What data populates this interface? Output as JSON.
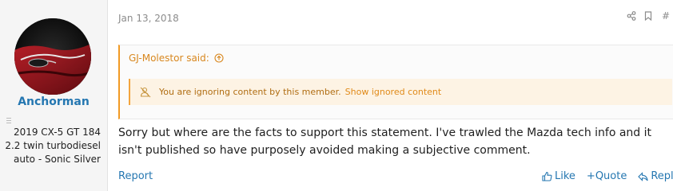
{
  "user": {
    "username": "Anchorman",
    "title": "2019 CX-5 GT 184 2.2 twin turbodiesel auto - Sonic Silver"
  },
  "post": {
    "date": "Jan 13, 2018",
    "number_fragment": "#",
    "quote": {
      "author_label": "GJ-Molestor said:",
      "ignored_text": "You are ignoring content by this member.",
      "ignored_link": "Show ignored content"
    },
    "body": "Sorry but where are the facts to support this statement. I've trawled the Mazda tech info and it isn't published so have purposely avoided making a subjective comment.",
    "footer": {
      "report_label": "Report",
      "like_label": "Like",
      "quote_label": "+Quote",
      "reply_label": "Reply"
    }
  },
  "icons": {
    "share": "share-icon",
    "bookmark": "bookmark-icon",
    "quote_arrow": "arrow-up-circle-icon",
    "ignored": "ignored-user-icon",
    "like": "thumbs-up-icon",
    "reply": "reply-icon"
  },
  "colors": {
    "link": "#2577b1",
    "quote_accent": "#f29a24",
    "ignored_bg": "#fdf3e4",
    "muted": "#8c8c8c"
  }
}
